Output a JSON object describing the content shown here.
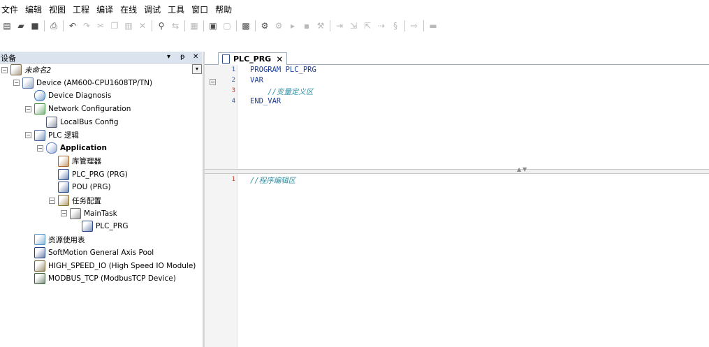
{
  "menu": [
    "文件",
    "编辑",
    "视图",
    "工程",
    "编译",
    "在线",
    "调试",
    "工具",
    "窗口",
    "帮助"
  ],
  "toolbar": {
    "icons": [
      {
        "name": "new-icon",
        "glyph": "▤",
        "dim": false
      },
      {
        "name": "open-icon",
        "glyph": "▰",
        "dim": false
      },
      {
        "name": "save-icon",
        "glyph": "■",
        "dim": false
      },
      {
        "sep": true
      },
      {
        "name": "print-icon",
        "glyph": "⎙",
        "dim": false
      },
      {
        "sep": true
      },
      {
        "name": "undo-icon",
        "glyph": "↶",
        "dim": false
      },
      {
        "name": "redo-icon",
        "glyph": "↷",
        "dim": true
      },
      {
        "name": "cut-icon",
        "glyph": "✂",
        "dim": true
      },
      {
        "name": "copy-icon",
        "glyph": "❐",
        "dim": true
      },
      {
        "name": "paste-icon",
        "glyph": "▥",
        "dim": true
      },
      {
        "name": "delete-icon",
        "glyph": "✕",
        "dim": true
      },
      {
        "sep": true
      },
      {
        "name": "find-icon",
        "glyph": "⚲",
        "dim": false
      },
      {
        "name": "replace-icon",
        "glyph": "⇆",
        "dim": true
      },
      {
        "sep": true
      },
      {
        "name": "select-all-icon",
        "glyph": "▦",
        "dim": true
      },
      {
        "sep": true
      },
      {
        "name": "add-object-icon",
        "glyph": "▣",
        "dim": false
      },
      {
        "name": "add-folder-icon",
        "glyph": "▢",
        "dim": true
      },
      {
        "sep": true
      },
      {
        "name": "build-icon",
        "glyph": "▩",
        "dim": false
      },
      {
        "sep": true
      },
      {
        "name": "login-icon",
        "glyph": "⚙",
        "dim": false
      },
      {
        "name": "logout-icon",
        "glyph": "⚙",
        "dim": true
      },
      {
        "name": "start-icon",
        "glyph": "▸",
        "dim": true
      },
      {
        "name": "stop-icon",
        "glyph": "▪",
        "dim": true
      },
      {
        "name": "reset-icon",
        "glyph": "⚒",
        "dim": true
      },
      {
        "sep": true
      },
      {
        "name": "step-over-icon",
        "glyph": "⇥",
        "dim": true
      },
      {
        "name": "step-into-icon",
        "glyph": "⇲",
        "dim": true
      },
      {
        "name": "step-out-icon",
        "glyph": "⇱",
        "dim": true
      },
      {
        "name": "run-to-cursor-icon",
        "glyph": "⇢",
        "dim": true
      },
      {
        "name": "set-next-icon",
        "glyph": "§",
        "dim": true
      },
      {
        "sep": true
      },
      {
        "name": "show-next-icon",
        "glyph": "⇨",
        "dim": true
      },
      {
        "sep": true
      },
      {
        "name": "toggle-breakpoint-icon",
        "glyph": "▬",
        "dim": true
      }
    ]
  },
  "device_panel": {
    "title": "设备",
    "pin_glyph": "ᵽ",
    "arrow_glyph": "▾",
    "close_glyph": "✕",
    "tree": [
      {
        "label": "未命名2",
        "italic": true,
        "bold": false,
        "indent": 0,
        "exp": "⊟",
        "icon": "project",
        "name": "tree-project"
      },
      {
        "label": "Device (AM600-CPU1608TP/TN)",
        "indent": 1,
        "exp": "⊟",
        "icon": "device",
        "name": "tree-device"
      },
      {
        "label": "Device Diagnosis",
        "indent": 2,
        "exp": "",
        "icon": "diagnosis",
        "name": "tree-device-diagnosis"
      },
      {
        "label": "Network Configuration",
        "indent": 2,
        "exp": "⊟",
        "icon": "network",
        "name": "tree-network-configuration"
      },
      {
        "label": "LocalBus Config",
        "indent": 3,
        "exp": "",
        "icon": "localbus",
        "name": "tree-localbus-config"
      },
      {
        "label": "PLC 逻辑",
        "indent": 2,
        "exp": "⊟",
        "icon": "plc",
        "name": "tree-plc-logic"
      },
      {
        "label": "Application",
        "bold": true,
        "indent": 3,
        "exp": "⊟",
        "icon": "application",
        "name": "tree-application"
      },
      {
        "label": "库管理器",
        "indent": 4,
        "exp": "",
        "icon": "library",
        "name": "tree-library-manager"
      },
      {
        "label": "PLC_PRG (PRG)",
        "indent": 4,
        "exp": "",
        "icon": "prg",
        "name": "tree-plc-prg"
      },
      {
        "label": "POU (PRG)",
        "indent": 4,
        "exp": "",
        "icon": "pou",
        "name": "tree-pou"
      },
      {
        "label": "任务配置",
        "indent": 4,
        "exp": "⊟",
        "icon": "task-config",
        "name": "tree-task-configuration"
      },
      {
        "label": "MainTask",
        "indent": 5,
        "exp": "⊟",
        "icon": "maintask",
        "name": "tree-maintask"
      },
      {
        "label": "PLC_PRG",
        "indent": 6,
        "exp": "",
        "icon": "prg-call",
        "name": "tree-maintask-plc-prg"
      },
      {
        "label": "资源使用表",
        "indent": 2,
        "exp": "",
        "icon": "resources",
        "name": "tree-resource-usage"
      },
      {
        "label": "SoftMotion General Axis Pool",
        "indent": 2,
        "exp": "",
        "icon": "axis",
        "name": "tree-softmotion-pool"
      },
      {
        "label": "HIGH_SPEED_IO (High Speed IO Module)",
        "indent": 2,
        "exp": "",
        "icon": "io",
        "name": "tree-high-speed-io"
      },
      {
        "label": "MODBUS_TCP (ModbusTCP Device)",
        "indent": 2,
        "exp": "",
        "icon": "modbus",
        "name": "tree-modbus-tcp"
      }
    ]
  },
  "editor": {
    "tab_label": "PLC_PRG",
    "tab_close": "✕",
    "decl_lines": [
      {
        "num": "1",
        "text": "PROGRAM PLC_PRG",
        "comment": false,
        "red": false
      },
      {
        "num": "2",
        "text": "VAR",
        "comment": false,
        "red": false
      },
      {
        "num": "3",
        "text": "    //变量定义区",
        "comment": true,
        "red": true
      },
      {
        "num": "4",
        "text": "END_VAR",
        "comment": false,
        "red": false
      }
    ],
    "impl_lines": [
      {
        "num": "1",
        "text": "//程序编辑区",
        "comment": true,
        "red": true
      }
    ],
    "splitter_glyphs": "▲▼"
  },
  "colors": {
    "keyword": "#1b3f9b",
    "comment": "#2e8fa3",
    "header_bg": "#dbe3ef"
  }
}
